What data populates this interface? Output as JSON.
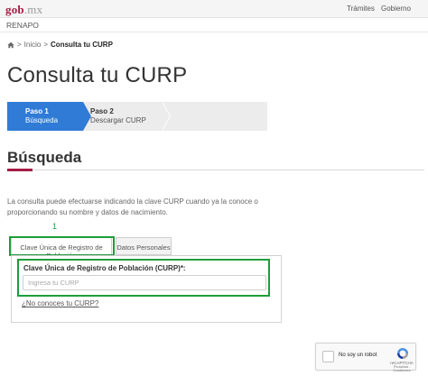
{
  "header": {
    "logo_main": "gob",
    "logo_dot": ".",
    "logo_suffix": "mx",
    "nav": [
      "Trámites",
      "Gobierno"
    ]
  },
  "subheader": {
    "title": "RENAPO"
  },
  "breadcrumb": {
    "home": "Inicio",
    "current": "Consulta tu CURP"
  },
  "page": {
    "title": "Consulta tu CURP"
  },
  "steps": [
    {
      "number": "Paso 1",
      "label": "Búsqueda",
      "active": true
    },
    {
      "number": "Paso 2",
      "label": "Descargar CURP",
      "active": false
    }
  ],
  "section": {
    "title": "Búsqueda",
    "intro": "La consulta puede efectuarse indicando la clave CURP cuando ya la conoce o proporcionando su nombre y datos de nacimiento."
  },
  "annotation": {
    "marker": "1",
    "color": "#1f9d3a"
  },
  "tabs": [
    {
      "label": "Clave Única de Registro de Población",
      "selected": true
    },
    {
      "label": "Datos Personales",
      "selected": false
    }
  ],
  "form": {
    "label": "Clave Única de Registro de Población (CURP)*:",
    "placeholder": "Ingresa tu CURP",
    "value": "",
    "help_link": "¿No conoces tu CURP?"
  },
  "recaptcha": {
    "label": "No soy un robot",
    "brand": "reCAPTCHA",
    "terms": "Privacidad - Condiciones"
  },
  "colors": {
    "brand": "#a51d46",
    "step_active": "#2f7bd6",
    "highlight": "#1f9d3a"
  },
  "icons": [
    "home-icon",
    "recaptcha-logo-icon"
  ]
}
